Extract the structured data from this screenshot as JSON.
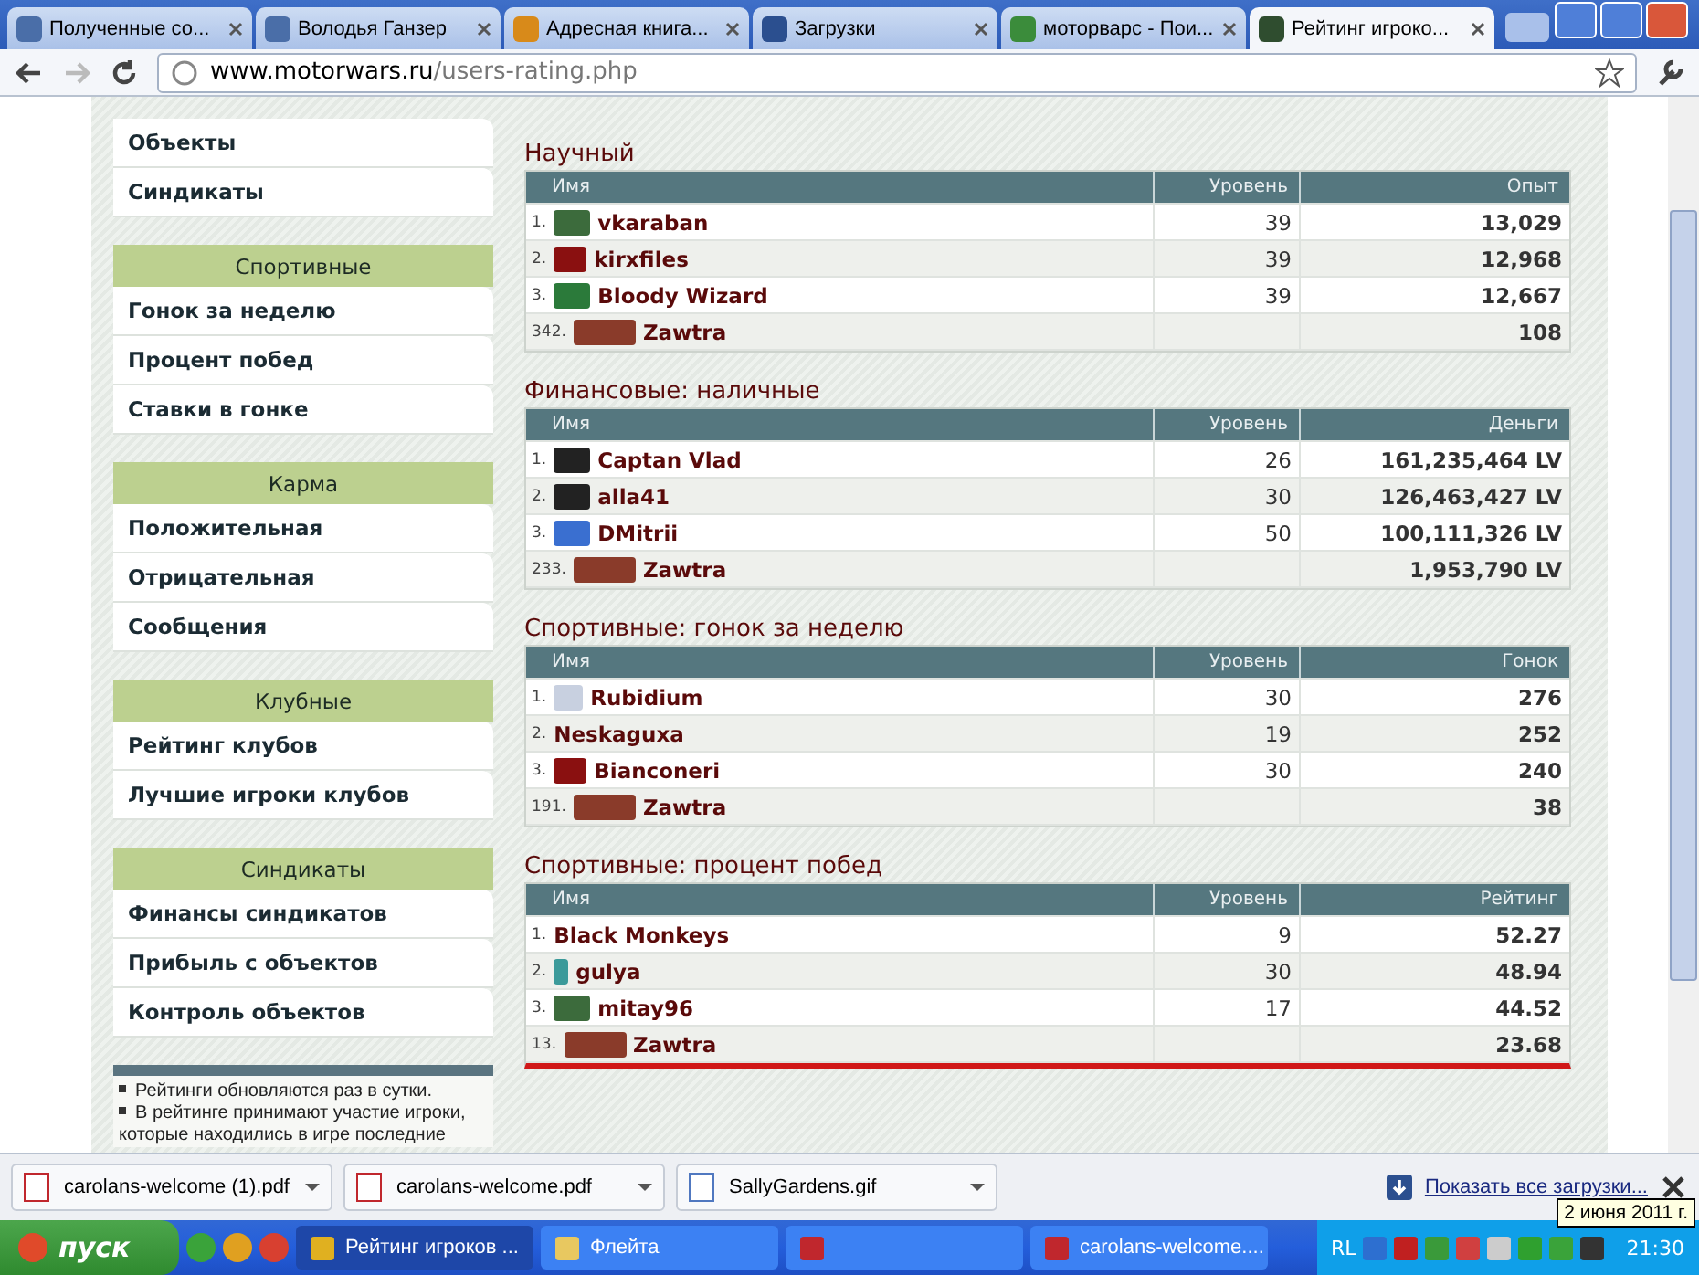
{
  "browser": {
    "tabs": [
      {
        "title": "Полученные со...",
        "selected": false
      },
      {
        "title": "Володья Ганзер",
        "selected": false
      },
      {
        "title": "Адресная книга...",
        "selected": false
      },
      {
        "title": "Загрузки",
        "selected": false
      },
      {
        "title": "моторварс - Пои...",
        "selected": false
      },
      {
        "title": "Рейтинг игроко...",
        "selected": true
      }
    ],
    "url_host": "www.motorwars.ru",
    "url_path": "/users-rating.php"
  },
  "sidebar": {
    "groups": [
      {
        "items": [
          "Объекты",
          "Синдикаты"
        ]
      },
      {
        "header": "Спортивные",
        "items": [
          "Гонок за неделю",
          "Процент побед",
          "Ставки в гонке"
        ]
      },
      {
        "header": "Карма",
        "items": [
          "Положительная",
          "Отрицательная",
          "Сообщения"
        ]
      },
      {
        "header": "Клубные",
        "items": [
          "Рейтинг клубов",
          "Лучшие игроки клубов"
        ]
      },
      {
        "header": "Синдикаты",
        "items": [
          "Финансы синдикатов",
          "Прибыль с объектов",
          "Контроль объектов"
        ]
      }
    ],
    "notes": [
      "Рейтинги обновляются раз в сутки.",
      "В рейтинге принимают участие игроки, которые находились в игре последние"
    ]
  },
  "ratings": [
    {
      "title": "Научный",
      "columns": [
        "Имя",
        "Уровень",
        "Опыт"
      ],
      "underlined": false,
      "rows": [
        {
          "rank": "1.",
          "name": "vkaraban",
          "kind": "emblem",
          "level": "39",
          "value": "13,029"
        },
        {
          "rank": "2.",
          "name": "kirxfiles",
          "kind": "letter",
          "level": "39",
          "value": "12,968"
        },
        {
          "rank": "3.",
          "name": "Bloody Wizard",
          "kind": "stripes",
          "level": "39",
          "value": "12,667"
        },
        {
          "rank": "342.",
          "name": "Zawtra",
          "kind": "car",
          "value": "108"
        }
      ]
    },
    {
      "title": "Финансовые: наличные",
      "columns": [
        "Имя",
        "Уровень",
        "Деньги"
      ],
      "underlined": false,
      "rows": [
        {
          "rank": "1.",
          "name": "Captan Vlad",
          "kind": "grille",
          "level": "26",
          "value": "161,235,464 LV"
        },
        {
          "rank": "2.",
          "name": "alla41",
          "kind": "grille",
          "level": "30",
          "value": "126,463,427 LV"
        },
        {
          "rank": "3.",
          "name": "DMitrii",
          "kind": "badge",
          "level": "50",
          "value": "100,111,326 LV"
        },
        {
          "rank": "233.",
          "name": "Zawtra",
          "kind": "car",
          "value": "1,953,790 LV"
        }
      ]
    },
    {
      "title": "Спортивные: гонок за неделю",
      "columns": [
        "Имя",
        "Уровень",
        "Гонок"
      ],
      "underlined": false,
      "rows": [
        {
          "rank": "1.",
          "name": "Rubidium",
          "kind": "flag",
          "level": "30",
          "value": "276"
        },
        {
          "rank": "2.",
          "name": "Neskaguxa",
          "kind": "plain",
          "level": "19",
          "value": "252"
        },
        {
          "rank": "3.",
          "name": "Bianconeri",
          "kind": "letter",
          "level": "30",
          "value": "240"
        },
        {
          "rank": "191.",
          "name": "Zawtra",
          "kind": "car",
          "value": "38"
        }
      ]
    },
    {
      "title": "Спортивные: процент побед",
      "columns": [
        "Имя",
        "Уровень",
        "Рейтинг"
      ],
      "underlined": true,
      "rows": [
        {
          "rank": "1.",
          "name": "Black Monkeys",
          "kind": "plain",
          "level": "9",
          "value": "52.27"
        },
        {
          "rank": "2.",
          "name": "gulya",
          "kind": "pin",
          "level": "30",
          "value": "48.94"
        },
        {
          "rank": "3.",
          "name": "mitay96",
          "kind": "emblem",
          "level": "17",
          "value": "44.52"
        },
        {
          "rank": "13.",
          "name": "Zawtra",
          "kind": "car",
          "value": "23.68"
        }
      ]
    }
  ],
  "downloads": {
    "items": [
      {
        "name": "carolans-welcome (1).pdf",
        "kind": "pdf"
      },
      {
        "name": "carolans-welcome.pdf",
        "kind": "pdf"
      },
      {
        "name": "SallyGardens.gif",
        "kind": "image"
      }
    ],
    "show_all": "Показать все загрузки..."
  },
  "taskbar": {
    "start": "пуск",
    "tasks": [
      {
        "title": "Рейтинг игроков ...",
        "selected": true
      },
      {
        "title": "Флейта",
        "selected": false
      },
      {
        "selected": false
      },
      {
        "title": "carolans-welcome....",
        "selected": false
      }
    ],
    "language": "RL",
    "clock": "21:30",
    "tooltip": "2 июня 2011 г."
  }
}
